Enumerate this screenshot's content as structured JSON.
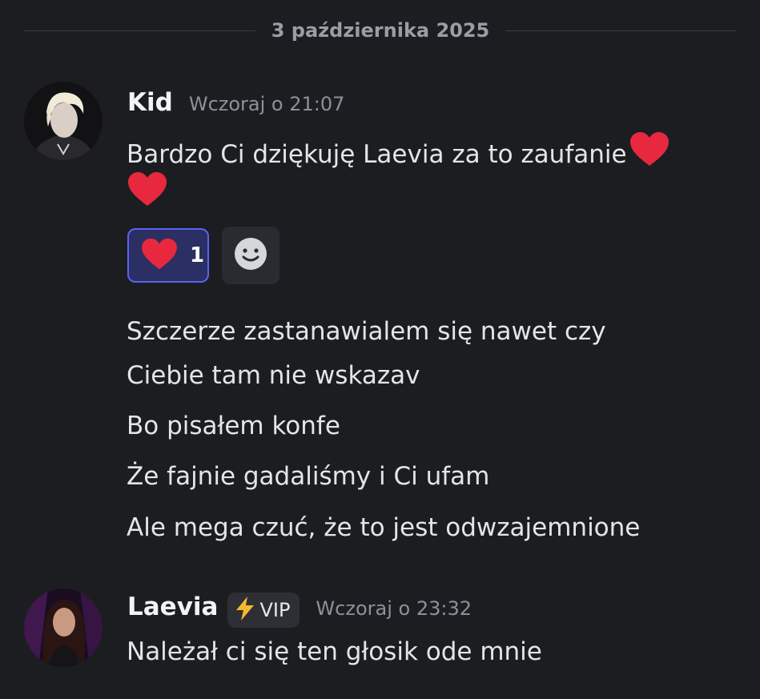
{
  "divider": {
    "date": "3 października 2025"
  },
  "messages": [
    {
      "username": "Kid",
      "timestamp": "Wczoraj o 21:07",
      "first_text": "Bardzo Ci dziękuję Laevia za to zaufanie",
      "reaction": {
        "emoji": "heart-icon",
        "count": "1"
      },
      "lines": [
        "Szczerze zastanawialem się nawet czy",
        "Ciebie tam nie wskazav",
        "Bo pisałem konfe",
        "Że fajnie gadaliśmy i Ci ufam",
        "Ale mega czuć, że to jest odwzajemnione"
      ]
    },
    {
      "username": "Laevia",
      "badge": "VIP",
      "timestamp": "Wczoraj o 23:32",
      "text": "Należał ci się ten głosik ode mnie"
    }
  ],
  "colors": {
    "background": "#1c1d21",
    "reaction_border": "#5865f2",
    "reaction_bg": "#2b2f63",
    "heart": "#e8283e"
  }
}
